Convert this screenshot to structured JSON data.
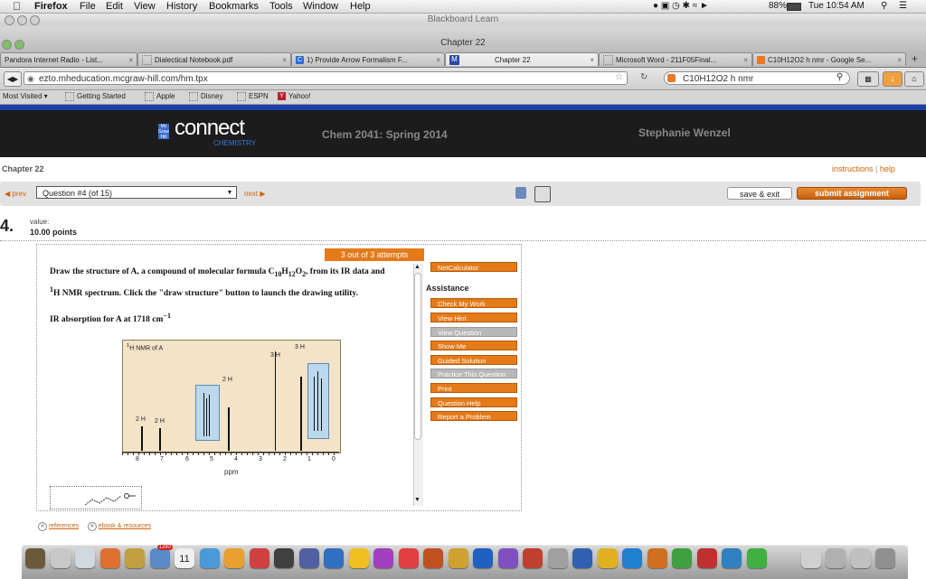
{
  "menubar": {
    "app": "Firefox",
    "items": [
      "File",
      "Edit",
      "View",
      "History",
      "Bookmarks",
      "Tools",
      "Window",
      "Help"
    ],
    "battery": "88%",
    "clock": "Tue 10:54 AM"
  },
  "window": {
    "title_back": "Blackboard Learn",
    "title_front": "Chapter 22"
  },
  "tabs": [
    {
      "label": "Pandora Internet Radio - List..."
    },
    {
      "label": "Dialectical Notebook.pdf"
    },
    {
      "label": "1) Provide Arrow Formalism F..."
    },
    {
      "label": "Chapter 22"
    },
    {
      "label": "Microsoft Word - 211F05Final..."
    },
    {
      "label": "C10H12O2 h nmr - Google Se..."
    }
  ],
  "nav": {
    "url": "ezto.mheducation.mcgraw-hill.com/hm.tpx",
    "search": "C10H12O2 h nmr"
  },
  "bookmarks": [
    "Most Visited",
    "Getting Started",
    "Apple",
    "Disney",
    "ESPN",
    "Yahoo!"
  ],
  "header": {
    "logo": "connect",
    "logo_sub": "CHEMISTRY",
    "course": "Chem 2041: Spring 2014",
    "user": "Stephanie Wenzel"
  },
  "page": {
    "chapter": "Chapter 22",
    "instructions": "instructions",
    "help": "help",
    "prev": "prev",
    "next": "next",
    "question_select": "Question #4 (of 15)",
    "save_exit": "save & exit",
    "submit": "submit assignment",
    "question_number": "4.",
    "value_label": "value:",
    "value_points": "10.00 points",
    "attempts": "3 out of 3 attempts",
    "question_text_1": "Draw the structure of A, a compound of molecular formula C",
    "formula_c": "10",
    "formula_h_prefix": "H",
    "formula_h": "12",
    "formula_o_prefix": "O",
    "formula_o": "2",
    "question_text_2": ", from its IR data and",
    "question_text_3": "H NMR spectrum. Click the \"draw structure\" button to launch the drawing utility.",
    "superscript_1": "1",
    "ir_text": "IR absorption for A at 1718 cm",
    "ir_exp": "−1",
    "nmr_title": "H NMR of A",
    "nmr_peaks": [
      "2 H",
      "2 H",
      "3 H",
      "2 H",
      "3 H"
    ],
    "axis_ticks": [
      "8",
      "7",
      "6",
      "5",
      "4",
      "3",
      "2",
      "1",
      "0"
    ],
    "axis_label": "ppm"
  },
  "assistance": {
    "netcalc": "NetCalculator",
    "title": "Assistance",
    "buttons": [
      {
        "label": "Check My Work",
        "enabled": true
      },
      {
        "label": "View Hint",
        "enabled": true
      },
      {
        "label": "View Question",
        "enabled": false
      },
      {
        "label": "Show Me",
        "enabled": true
      },
      {
        "label": "Guided Solution",
        "enabled": true
      },
      {
        "label": "Practice This Question",
        "enabled": false
      },
      {
        "label": "Print",
        "enabled": true
      },
      {
        "label": "Question Help",
        "enabled": true
      },
      {
        "label": "Report a Problem",
        "enabled": true
      }
    ]
  },
  "footer": {
    "references": "references",
    "ebook": "ebook & resources"
  },
  "dock": {
    "calendar_day": "11",
    "badge": "1290"
  }
}
